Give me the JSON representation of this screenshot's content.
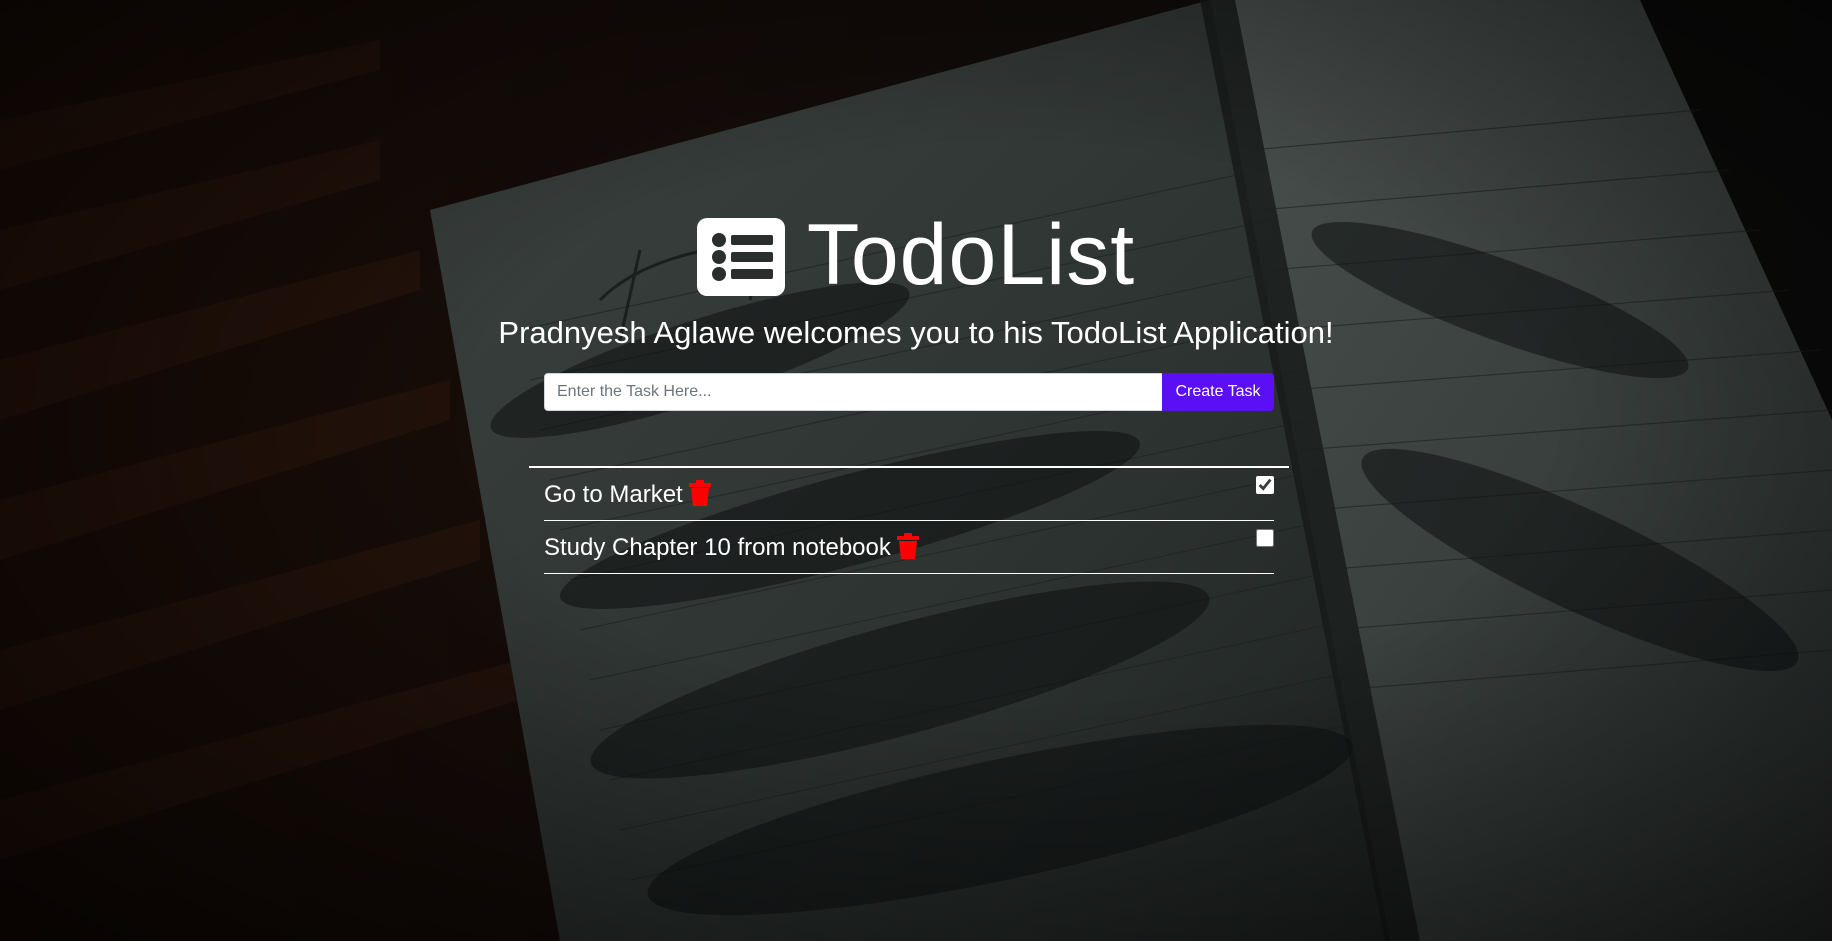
{
  "app": {
    "title": "TodoList",
    "logo_icon": "list-icon",
    "welcome": "Pradnyesh Aglawe welcomes you to his TodoList Application!"
  },
  "form": {
    "input_value": "",
    "input_placeholder": "Enter the Task Here...",
    "submit_label": "Create Task",
    "submit_color": "#5b0ff5"
  },
  "tasks": [
    {
      "text": "Go to Market",
      "completed": true,
      "delete_icon": "trash-icon"
    },
    {
      "text": "Study Chapter 10 from notebook",
      "completed": false,
      "delete_icon": "trash-icon"
    }
  ],
  "colors": {
    "delete_icon": "#ff0000",
    "text": "#ffffff"
  }
}
